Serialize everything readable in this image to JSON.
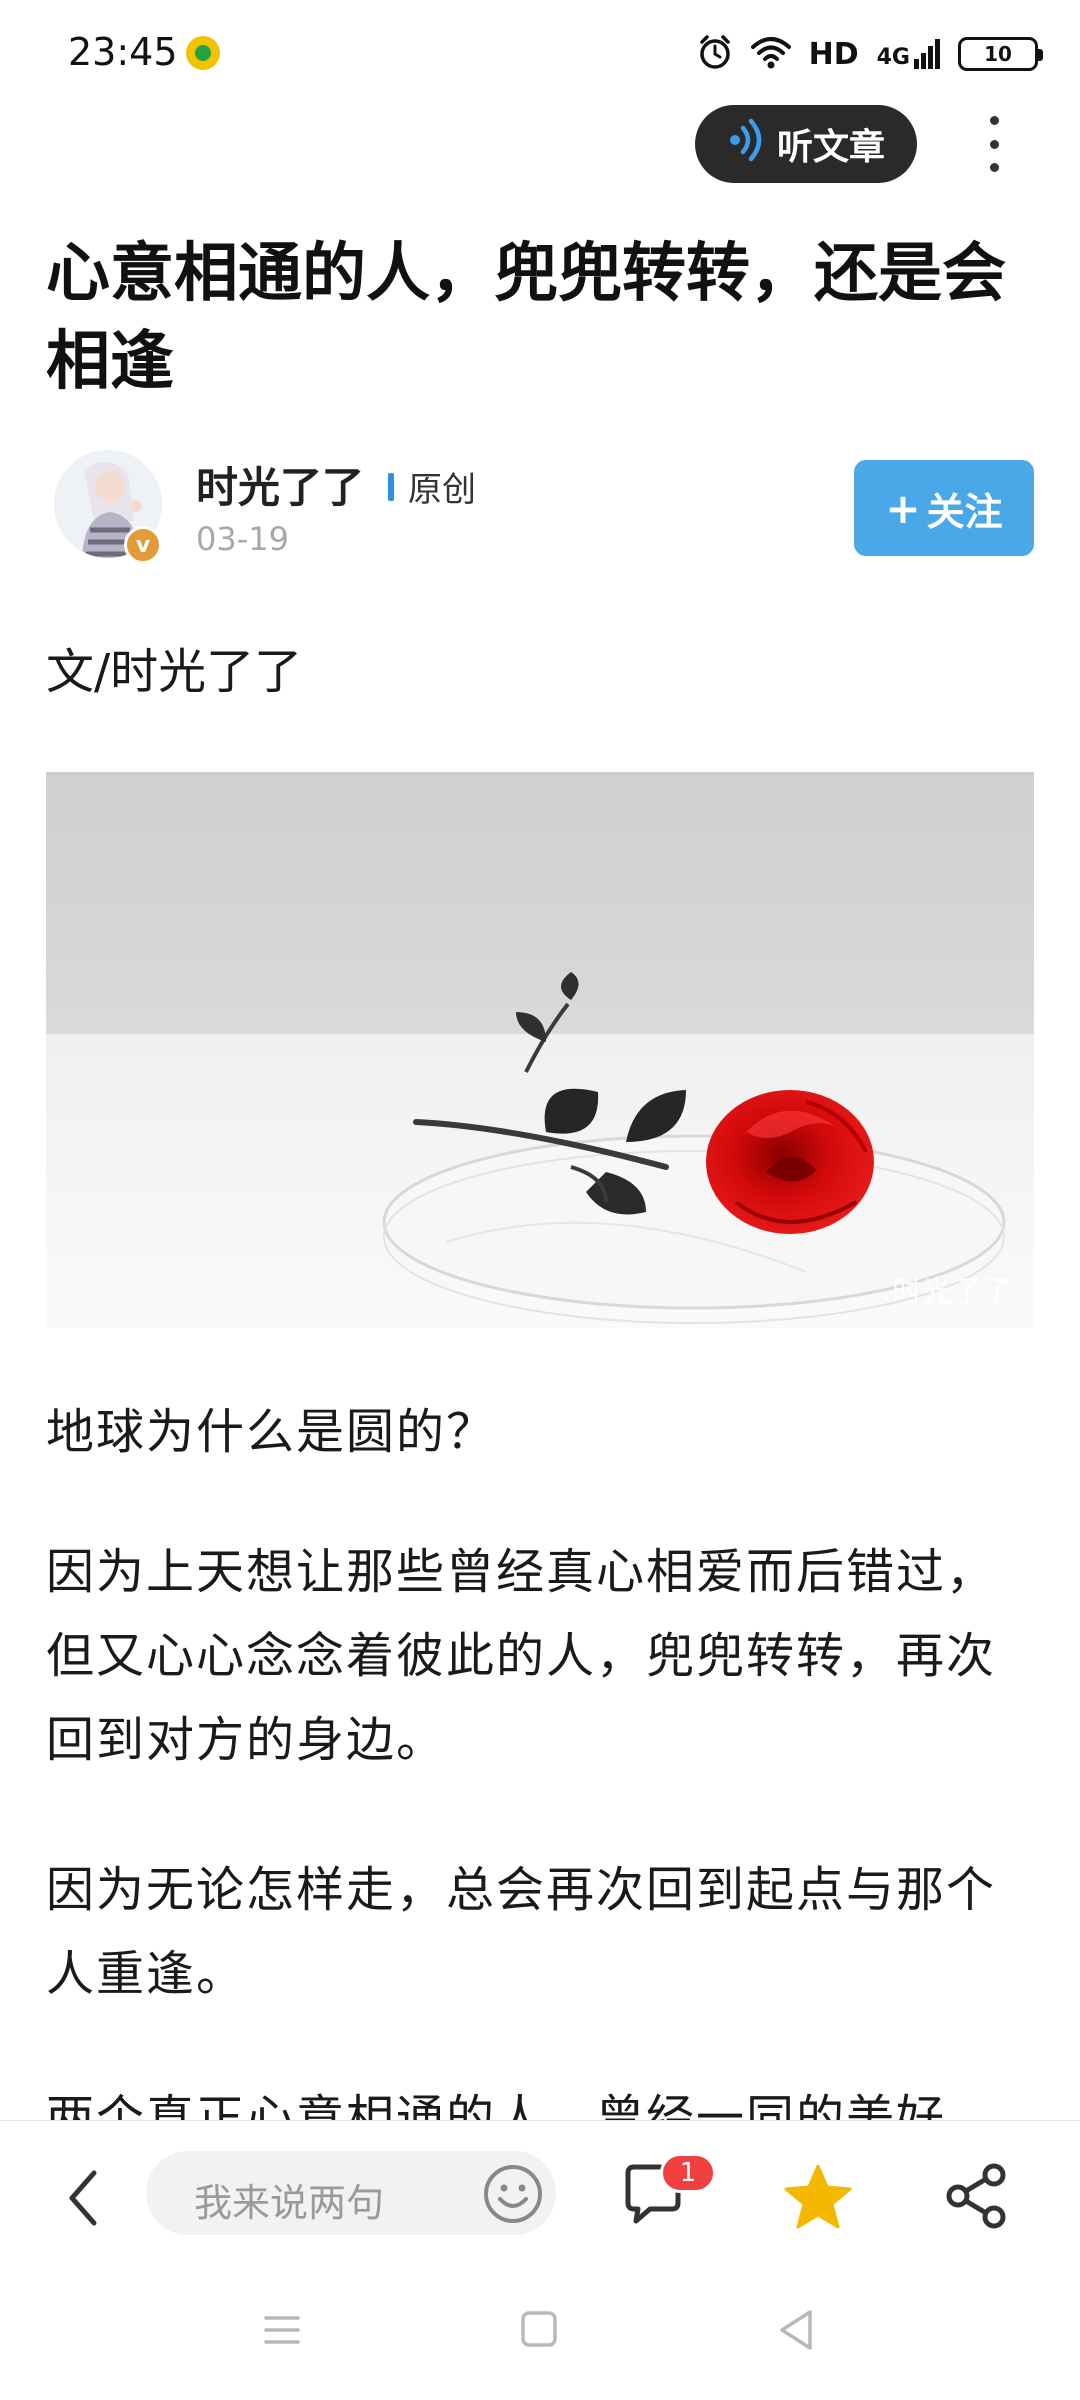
{
  "status_bar": {
    "time": "23:45",
    "hd_label": "HD",
    "network": "4G",
    "battery": "10"
  },
  "header": {
    "listen_label": "听文章"
  },
  "article": {
    "title": "心意相通的人，兜兜转转，还是会相逢",
    "author": "时光了了",
    "original_label": "原创",
    "date": "03-19",
    "follow_label": "关注",
    "byline": "文/时光了了",
    "image_watermark": "时光了了",
    "paragraphs": [
      "地球为什么是圆的？",
      "因为上天想让那些曾经真心相爱而后错过，但又心心念念着彼此的人，兜兜转转，再次回到对方的身边。",
      "因为无论怎样走，总会再次回到起点与那个人重逢。",
      "两个真正心意相通的人，曾经一同的美好"
    ]
  },
  "toolbar": {
    "comment_placeholder": "我来说两句",
    "comment_count": "1"
  },
  "colors": {
    "accent_blue": "#4aa8e8",
    "badge_red": "#f04040",
    "star_yellow": "#f5b800",
    "pill_dark": "#2a2a2a"
  },
  "icons": [
    "clock-icon",
    "wifi-icon",
    "signal-icon",
    "battery-icon",
    "sound-wave-icon",
    "more-vertical-icon",
    "verified-badge-icon",
    "back-chevron-icon",
    "emoji-icon",
    "comment-icon",
    "star-icon",
    "share-icon",
    "nav-menu-icon",
    "nav-home-icon",
    "nav-back-icon"
  ]
}
